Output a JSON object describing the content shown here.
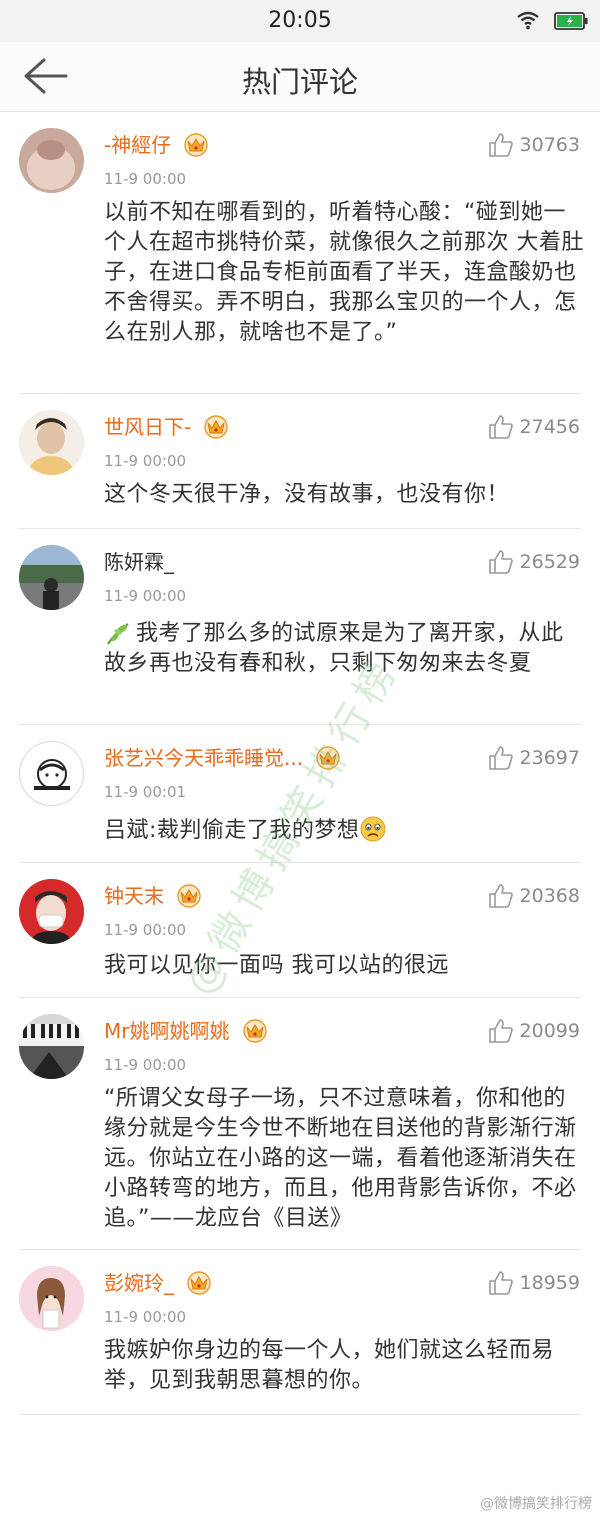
{
  "status_bar": {
    "time": "20:05"
  },
  "header": {
    "title": "热门评论"
  },
  "comments": [
    {
      "username": "-神經仔",
      "vip": true,
      "likes": "30763",
      "time": "11-9 00:00",
      "text": "以前不知在哪看到的，听着特心酸：“碰到她一个人在超市挑特价菜，就像很久之前那次 大着肚子，在进口食品专柜前面看了半天，连盒酸奶也不舍得买。弄不明白，我那么宝贝的一个人，怎么在别人那，就啥也不是了。”"
    },
    {
      "username": "世风日下-",
      "vip": true,
      "likes": "27456",
      "time": "11-9 00:00",
      "text": "这个冬天很干净，没有故事，也没有你！"
    },
    {
      "username": "陈妍霖_",
      "vip": false,
      "likes": "26529",
      "time": "11-9 00:00",
      "text": "我考了那么多的试原来是为了离开家，从此故乡再也没有春和秋，只剩下匆匆来去冬夏"
    },
    {
      "username": "张艺兴今天乖乖睡觉...",
      "vip": true,
      "likes": "23697",
      "time": "11-9 00:01",
      "text": "吕斌:裁判偷走了我的梦想"
    },
    {
      "username": "钟天末",
      "vip": true,
      "likes": "20368",
      "time": "11-9 00:00",
      "text": "我可以见你一面吗 我可以站的很远"
    },
    {
      "username": "Mr姚啊姚啊姚",
      "vip": true,
      "likes": "20099",
      "time": "11-9 00:00",
      "text": "“所谓父女母子一场，只不过意味着，你和他的缘分就是今生今世不断地在目送他的背影渐行渐远。你站立在小路的这一端，看着他逐渐消失在小路转弯的地方，而且，他用背影告诉你，不必追。”——龙应台《目送》"
    },
    {
      "username": "彭婉玲_",
      "vip": true,
      "likes": "18959",
      "time": "11-9 00:00",
      "text": "我嫉妒你身边的每一个人，她们就这么轻而易举，见到我朝思暮想的你。"
    }
  ],
  "watermark": "@微博搞笑排行榜",
  "corner_watermark": "@微博搞笑排行榜",
  "colors": {
    "username": "#e86a1a",
    "accent_crown": "#f5a623",
    "battery": "#2bb24c"
  }
}
